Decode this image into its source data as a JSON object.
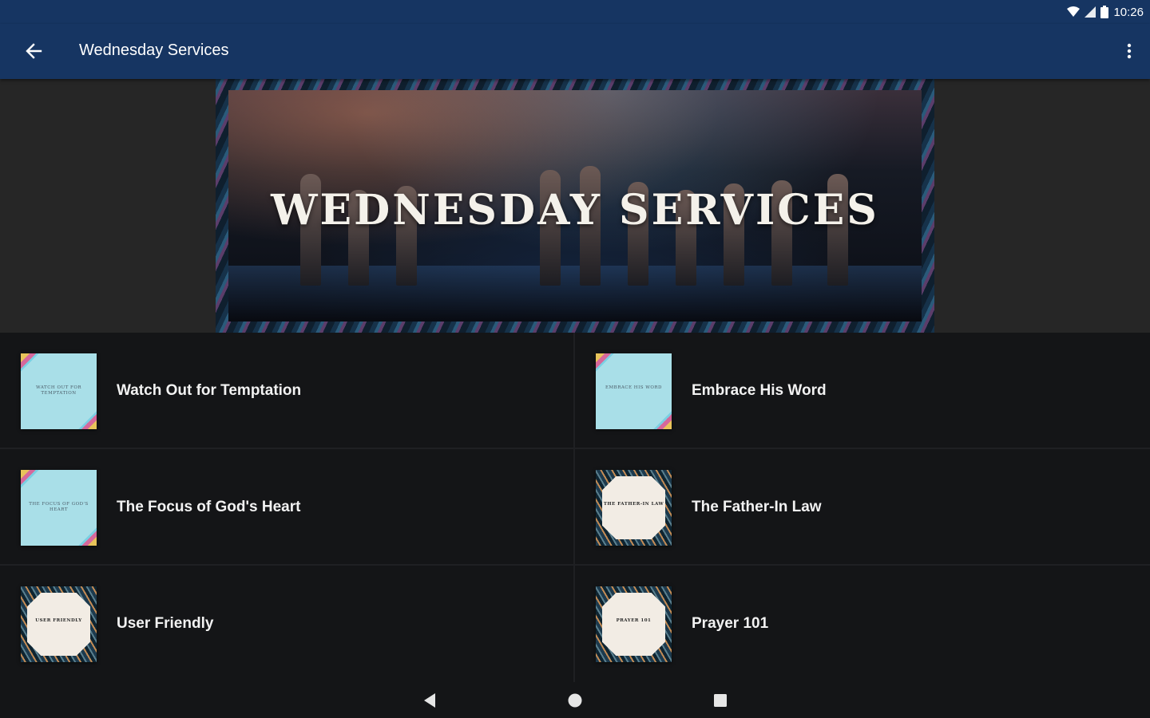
{
  "status_bar": {
    "time": "10:26",
    "icons": [
      "wifi-icon",
      "signal-icon",
      "battery-icon"
    ]
  },
  "app_bar": {
    "title": "Wednesday Services",
    "back_icon": "arrow-left-icon",
    "menu_icon": "more-vertical-icon",
    "color": "#163562"
  },
  "banner": {
    "text": "WEDNESDAY SERVICES"
  },
  "items": [
    {
      "title": "Watch Out for Temptation",
      "thumb_text": "WATCH OUT FOR TEMPTATION",
      "thumb_style": "cyan"
    },
    {
      "title": "Embrace His Word",
      "thumb_text": "EMBRACE HIS WORD",
      "thumb_style": "cyan"
    },
    {
      "title": "The Focus of God's Heart",
      "thumb_text": "THE FOCUS OF GOD'S HEART",
      "thumb_style": "cyan"
    },
    {
      "title": "The Father-In Law",
      "thumb_text": "THE FATHER-IN LAW",
      "thumb_style": "pattern"
    },
    {
      "title": "User Friendly",
      "thumb_text": "USER FRIENDLY",
      "thumb_style": "pattern"
    },
    {
      "title": "Prayer 101",
      "thumb_text": "PRAYER 101",
      "thumb_style": "pattern"
    }
  ],
  "nav_bar": {
    "buttons": [
      "back-triangle-icon",
      "home-circle-icon",
      "recents-square-icon"
    ]
  }
}
